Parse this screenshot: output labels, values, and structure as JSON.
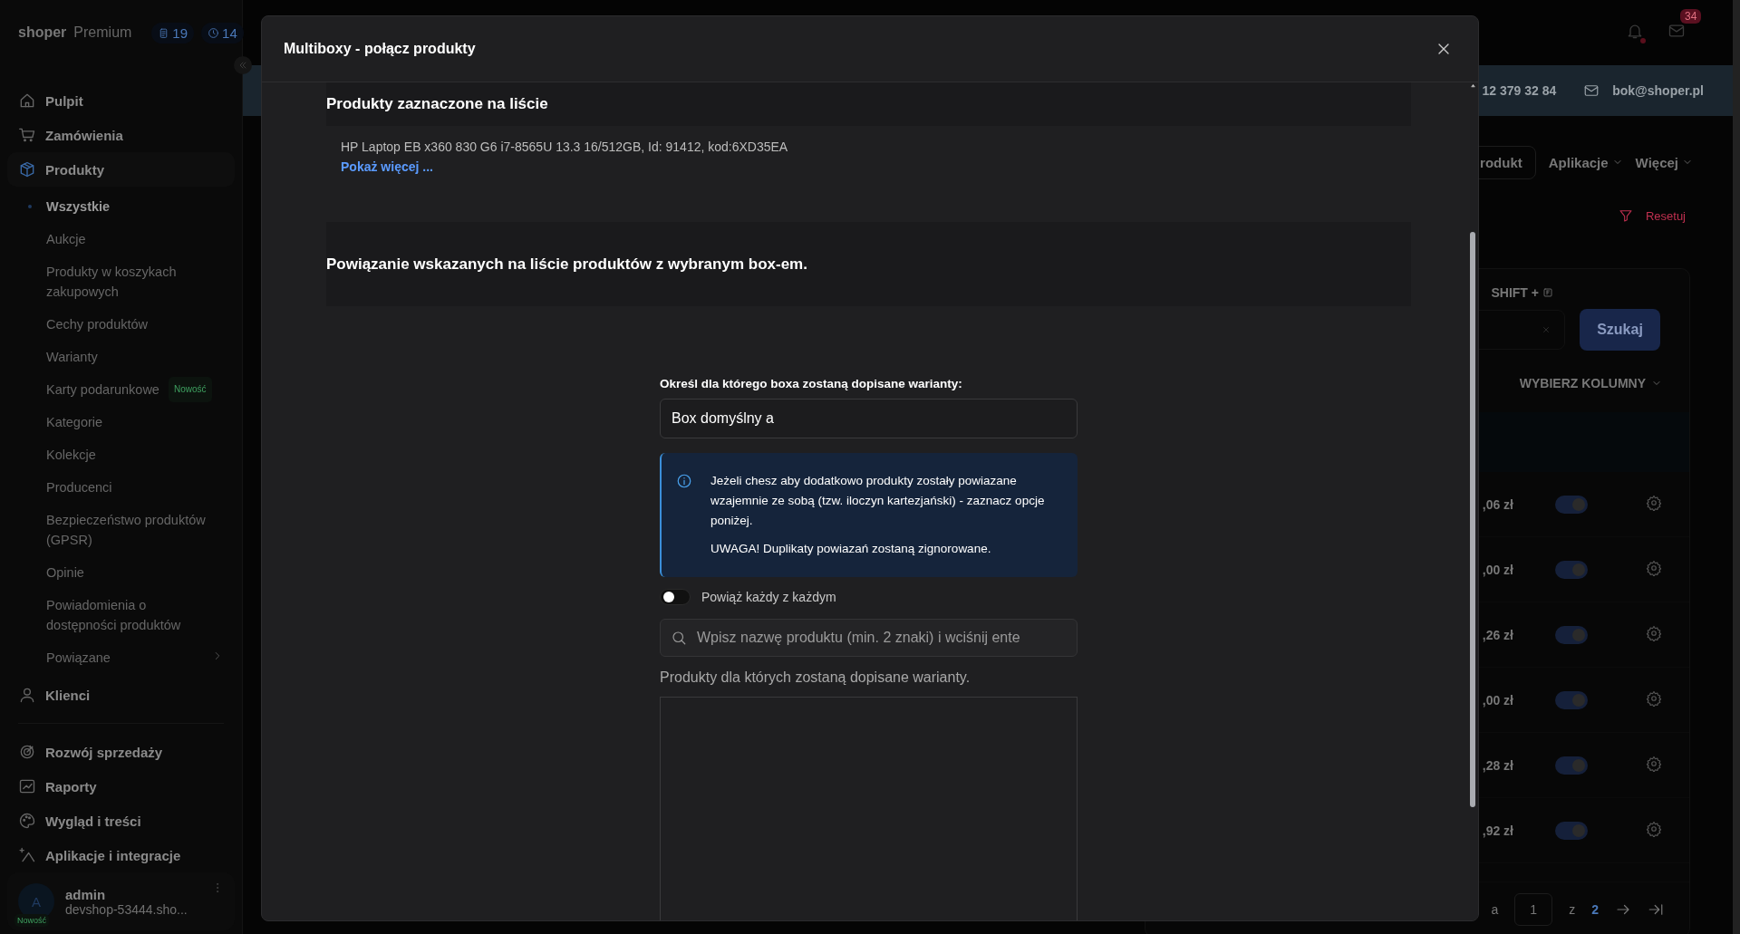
{
  "sidebar": {
    "brand": {
      "name": "shoper",
      "plan": "Premium"
    },
    "counters": [
      {
        "kind": "list",
        "count": "19"
      },
      {
        "kind": "clock",
        "count": "14"
      }
    ],
    "nav": [
      {
        "label": "Pulpit",
        "kind": "home",
        "selected": false
      },
      {
        "label": "Zamówienia",
        "kind": "cart",
        "selected": false
      },
      {
        "label": "Produkty",
        "kind": "box",
        "selected": true,
        "children": [
          {
            "label": "Wszystkie",
            "selected": true
          },
          {
            "label": "Aukcje",
            "selected": false
          },
          {
            "label": "Produkty w koszykach zakupowych",
            "selected": false
          },
          {
            "label": "Cechy produktów",
            "selected": false
          },
          {
            "label": "Warianty",
            "selected": false
          },
          {
            "label": "Karty podarunkowe",
            "selected": false,
            "badge": "Nowość"
          },
          {
            "label": "Kategorie",
            "selected": false
          },
          {
            "label": "Kolekcje",
            "selected": false
          },
          {
            "label": "Producenci",
            "selected": false
          },
          {
            "label": "Bezpieczeństwo produktów (GPSR)",
            "selected": false
          },
          {
            "label": "Opinie",
            "selected": false
          },
          {
            "label": "Powiadomienia o dostępności produktów",
            "selected": false
          },
          {
            "label": "Powiązane",
            "selected": false,
            "expandable": true
          }
        ]
      },
      {
        "label": "Klienci",
        "kind": "user",
        "selected": false
      },
      {
        "kind": "divider"
      },
      {
        "label": "Rozwój sprzedaży",
        "kind": "target",
        "selected": false
      },
      {
        "label": "Raporty",
        "kind": "chart",
        "selected": false
      },
      {
        "label": "Wygląd i treści",
        "kind": "palette",
        "selected": false
      },
      {
        "label": "Aplikacje i integracje",
        "kind": "sparkle",
        "selected": false
      }
    ],
    "user": {
      "initial": "A",
      "badge": "Nowość",
      "name": "admin",
      "shop": "devshop-53444.sho..."
    }
  },
  "topbar": {
    "mail_count": "34"
  },
  "contact": {
    "phone": "12 379 32 84",
    "email": "bok@shoper.pl"
  },
  "toolbar": [
    {
      "kind": "button",
      "label": "rodukt"
    },
    {
      "kind": "dropdown",
      "label": "Aplikacje"
    },
    {
      "kind": "dropdown",
      "label": "Więcej"
    }
  ],
  "filters": {
    "reset": "Resetuj",
    "shortcut": "SHIFT +",
    "search_button": "Szukaj",
    "columns": "WYBIERZ KOLUMNY"
  },
  "rows": [
    {
      "price": ",06 zł",
      "on": true
    },
    {
      "price": ",00 zł",
      "on": true
    },
    {
      "price": ",26 zł",
      "on": true
    },
    {
      "price": ",00 zł",
      "on": true
    },
    {
      "price": ",28 zł",
      "on": true
    },
    {
      "price": ",92 zł",
      "on": true
    }
  ],
  "pagination": {
    "label": "a",
    "page": "1",
    "of": "z",
    "total": "2"
  },
  "modal": {
    "title": "Multiboxy - połącz produkty",
    "selected_heading": "Produkty zaznaczone na liście",
    "products": [
      "HP Laptop EB x360 830 G6 i7-8565U 13.3 16/512GB, Id: 91412, kod:6XD35EA"
    ],
    "show_more": "Pokaż więcej ...",
    "link_heading": "Powiązanie wskazanych na liście produktów z wybranym box-em.",
    "box_label": "Określ dla którego boxa zostaną dopisane warianty:",
    "box_value": "Box domyślny a",
    "info": [
      "Jeżeli chesz aby dodatkowo produkty zostały powiazane wzajemnie ze sobą (tzw. iloczyn kartezjański) - zaznacz opcje poniżej.",
      "UWAGA! Duplikaty powiazań zostaną zignorowane."
    ],
    "toggle": {
      "label": "Powiąż każdy z każdym",
      "on": false
    },
    "search": {
      "placeholder": "Wpisz nazwę produktu (min. 2 znaki) i wciśnij ente"
    },
    "list_label": "Produkty dla których zostaną dopisane warianty."
  }
}
